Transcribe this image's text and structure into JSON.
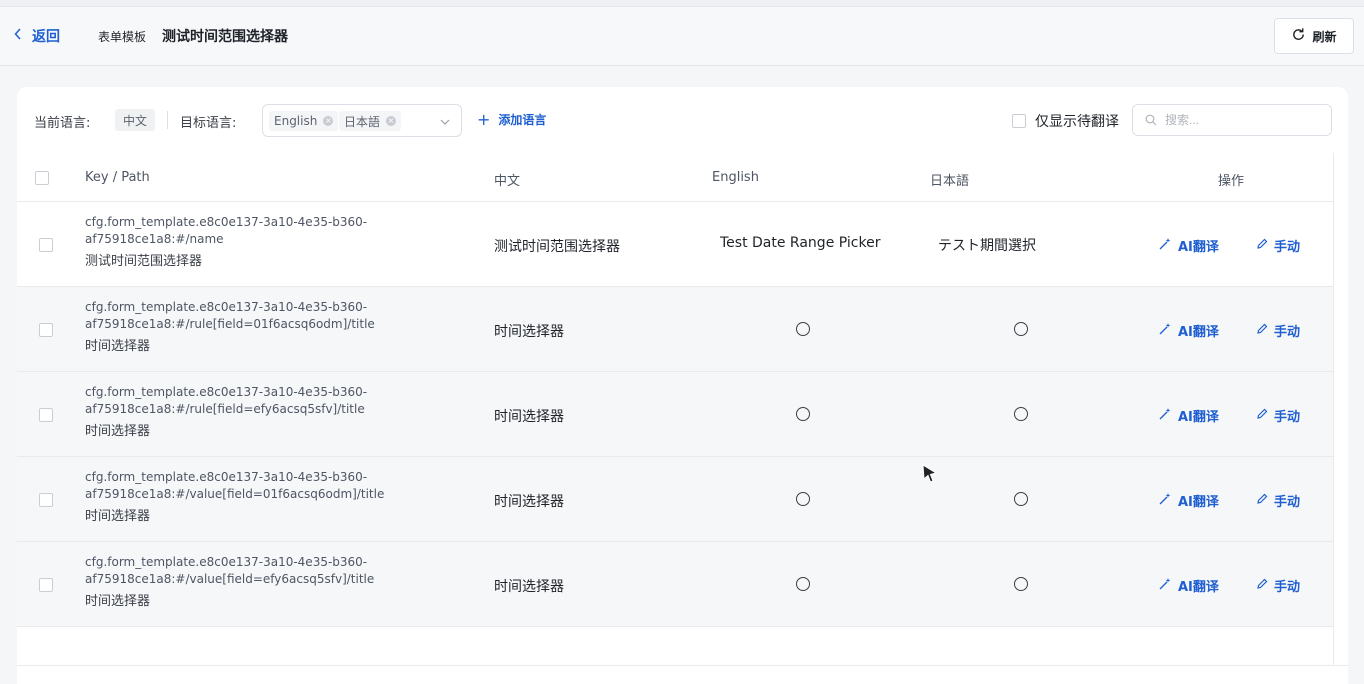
{
  "header": {
    "back_label": "返回",
    "crumb_tag": "表单模板",
    "title": "测试时间范围选择器",
    "refresh_label": "刷新"
  },
  "toolbar": {
    "current_lang_label": "当前语言:",
    "current_lang": "中文",
    "target_lang_label": "目标语言:",
    "target_langs": [
      "English",
      "日本語"
    ],
    "add_lang_label": "添加语言",
    "only_pending_label": "仅显示待翻译",
    "search_placeholder": "搜索..."
  },
  "table": {
    "columns": [
      "Key / Path",
      "中文",
      "English",
      "日本語",
      "操作"
    ],
    "actions": {
      "ai": "AI翻译",
      "manual": "手动"
    },
    "rows": [
      {
        "key_line1": "cfg.form_template.e8c0e137-3a10-4e35-b360-",
        "key_line2": "af75918ce1a8:#/name",
        "name": "测试时间范围选择器",
        "zh": "测试时间范围选择器",
        "en": "Test Date Range Picker",
        "ja": "テスト期間選択"
      },
      {
        "key_line1": "cfg.form_template.e8c0e137-3a10-4e35-b360-",
        "key_line2": "af75918ce1a8:#/rule[field=01f6acsq6odm]/title",
        "name": "时间选择器",
        "zh": "时间选择器",
        "en": "",
        "ja": ""
      },
      {
        "key_line1": "cfg.form_template.e8c0e137-3a10-4e35-b360-",
        "key_line2": "af75918ce1a8:#/rule[field=efy6acsq5sfv]/title",
        "name": "时间选择器",
        "zh": "时间选择器",
        "en": "",
        "ja": ""
      },
      {
        "key_line1": "cfg.form_template.e8c0e137-3a10-4e35-b360-",
        "key_line2": "af75918ce1a8:#/value[field=01f6acsq6odm]/title",
        "name": "时间选择器",
        "zh": "时间选择器",
        "en": "",
        "ja": ""
      },
      {
        "key_line1": "cfg.form_template.e8c0e137-3a10-4e35-b360-",
        "key_line2": "af75918ce1a8:#/value[field=efy6acsq5sfv]/title",
        "name": "时间选择器",
        "zh": "时间选择器",
        "en": "",
        "ja": ""
      }
    ]
  },
  "colors": {
    "accent": "#1f5fd1",
    "text": "#1f2329",
    "muted": "#4e5563"
  }
}
